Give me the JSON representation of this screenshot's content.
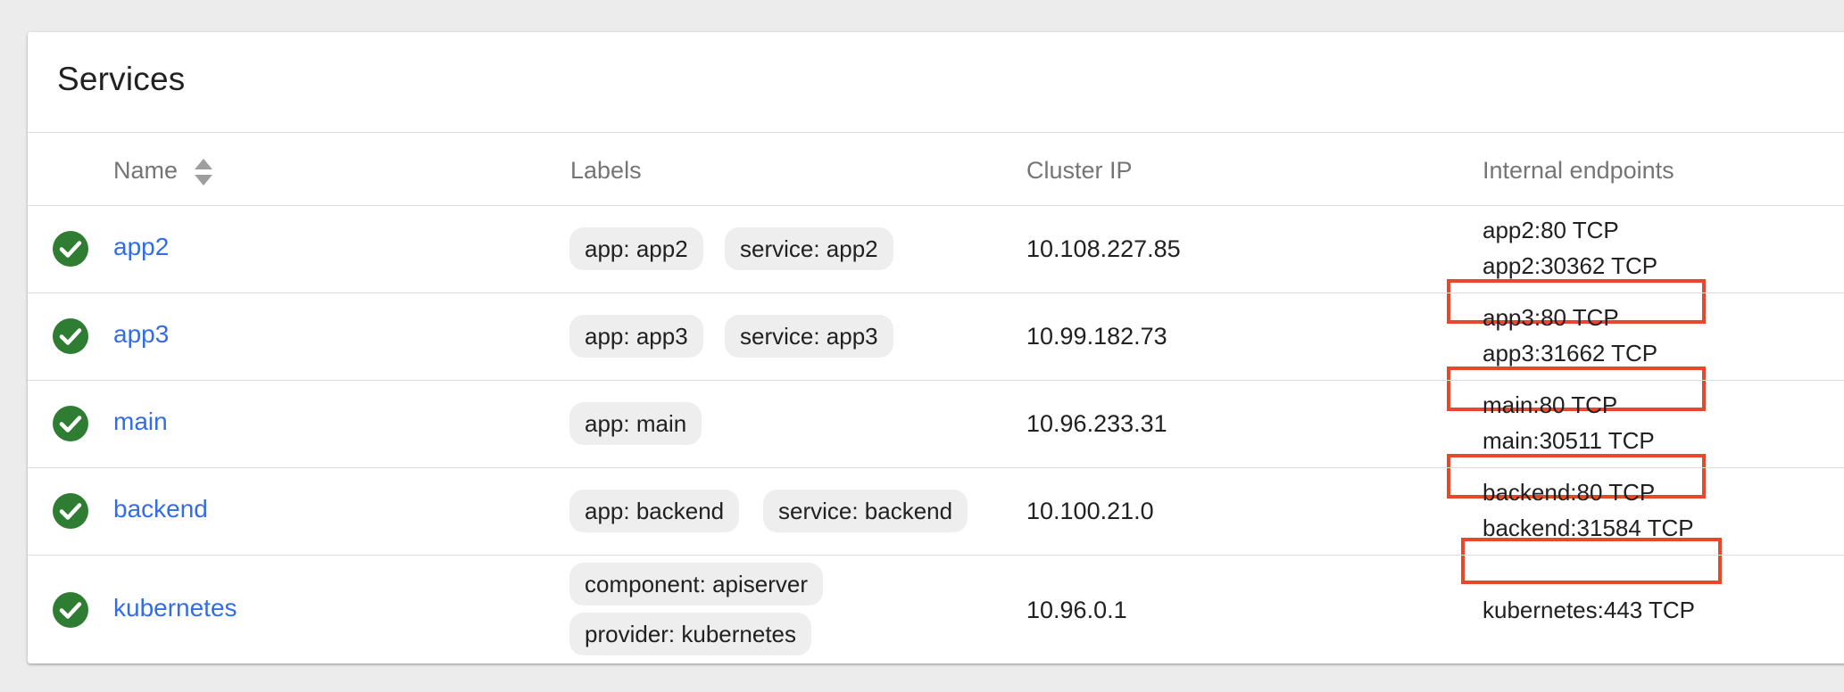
{
  "card": {
    "title": "Services"
  },
  "columns": {
    "name": "Name",
    "labels": "Labels",
    "cluster_ip": "Cluster IP",
    "internal_endpoints": "Internal endpoints"
  },
  "colors": {
    "status_ok": "#2e7d32",
    "link": "#326de6",
    "highlight": "#e8472c",
    "chip_bg": "#eeeeee"
  },
  "rows": [
    {
      "status": "check-circle-icon",
      "name": "app2",
      "labels": [
        "app: app2",
        "service: app2"
      ],
      "cluster_ip": "10.108.227.85",
      "endpoints": [
        "app2:80 TCP",
        "app2:30362 TCP"
      ],
      "highlighted_endpoint": "app2:30362 TCP"
    },
    {
      "status": "check-circle-icon",
      "name": "app3",
      "labels": [
        "app: app3",
        "service: app3"
      ],
      "cluster_ip": "10.99.182.73",
      "endpoints": [
        "app3:80 TCP",
        "app3:31662 TCP"
      ],
      "highlighted_endpoint": "app3:31662 TCP"
    },
    {
      "status": "check-circle-icon",
      "name": "main",
      "labels": [
        "app: main"
      ],
      "cluster_ip": "10.96.233.31",
      "endpoints": [
        "main:80 TCP",
        "main:30511 TCP"
      ],
      "highlighted_endpoint": "main:30511 TCP"
    },
    {
      "status": "check-circle-icon",
      "name": "backend",
      "labels": [
        "app: backend",
        "service: backend"
      ],
      "cluster_ip": "10.100.21.0",
      "endpoints": [
        "backend:80 TCP",
        "backend:31584 TCP"
      ],
      "highlighted_endpoint": "backend:31584 TCP"
    },
    {
      "status": "check-circle-icon",
      "name": "kubernetes",
      "labels": [
        "component: apiserver",
        "provider: kubernetes"
      ],
      "cluster_ip": "10.96.0.1",
      "endpoints": [
        "kubernetes:443 TCP"
      ]
    }
  ]
}
